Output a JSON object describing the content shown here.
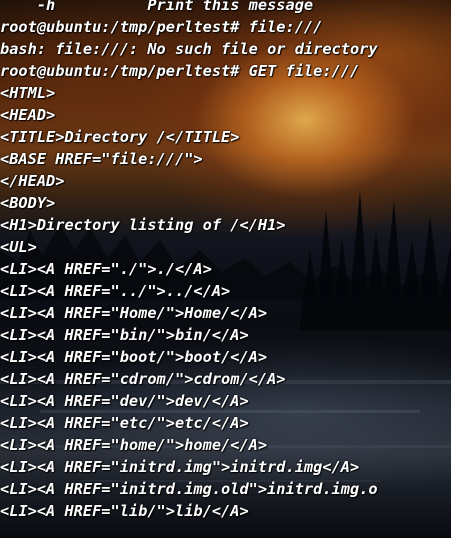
{
  "terminal": {
    "lines": [
      "    -h          Print this message",
      "root@ubuntu:/tmp/perltest# file:///",
      "bash: file:///: No such file or directory",
      "root@ubuntu:/tmp/perltest# GET file:///",
      "<HTML>",
      "<HEAD>",
      "<TITLE>Directory /</TITLE>",
      "<BASE HREF=\"file:///\">",
      "</HEAD>",
      "<BODY>",
      "<H1>Directory listing of /</H1>",
      "<UL>",
      "<LI><A HREF=\"./\">./</A>",
      "<LI><A HREF=\"../\">../</A>",
      "<LI><A HREF=\"Home/\">Home/</A>",
      "<LI><A HREF=\"bin/\">bin/</A>",
      "<LI><A HREF=\"boot/\">boot/</A>",
      "<LI><A HREF=\"cdrom/\">cdrom/</A>",
      "<LI><A HREF=\"dev/\">dev/</A>",
      "<LI><A HREF=\"etc/\">etc/</A>",
      "<LI><A HREF=\"home/\">home/</A>",
      "<LI><A HREF=\"initrd.img\">initrd.img</A>",
      "<LI><A HREF=\"initrd.img.old\">initrd.img.o",
      "<LI><A HREF=\"lib/\">lib/</A>"
    ]
  }
}
